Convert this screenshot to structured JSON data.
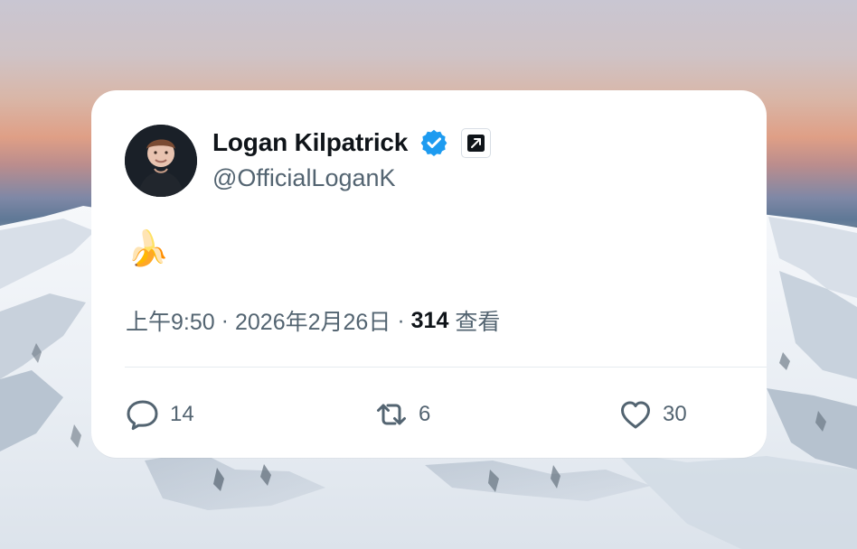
{
  "tweet": {
    "author": {
      "display_name": "Logan Kilpatrick",
      "handle": "@OfficialLoganK",
      "verified": true,
      "verified_color": "#1d9bf0",
      "avatar_icon": "profile-photo",
      "affiliation_icon": "external-link-square-icon"
    },
    "content": {
      "text": "🍌"
    },
    "meta": {
      "time": "上午9:50",
      "separator_1": "·",
      "date": "2026年2月26日",
      "separator_2": "·",
      "views": "314",
      "views_label": "查看"
    },
    "actions": {
      "reply": {
        "icon": "reply-icon",
        "count": "14"
      },
      "retweet": {
        "icon": "retweet-icon",
        "count": "6"
      },
      "like": {
        "icon": "heart-icon",
        "count": "30"
      }
    }
  },
  "colors": {
    "text_primary": "#0f1419",
    "text_secondary": "#536471",
    "card_background": "#ffffff",
    "divider": "#e6ecf0",
    "verified_blue": "#1d9bf0"
  }
}
